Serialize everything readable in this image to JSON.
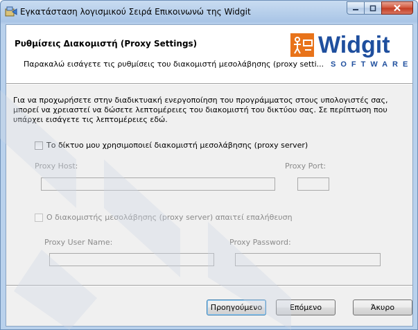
{
  "window": {
    "title": "Εγκατάσταση λογισμικού Σειρά Επικοινωνώ της Widgit",
    "icon": "installer-icon"
  },
  "banner": {
    "title": "Ρυθμίσεις Διακομιστή (Proxy Settings)",
    "description": "Παρακαλώ εισάγετε τις ρυθμίσεις του διακομιστή μεσολάβησης (proxy setti..."
  },
  "logo": {
    "brand": "Widgit",
    "tagline": "SOFTWARE",
    "colors": {
      "brand_blue": "#1f4f9e",
      "badge_orange": "#e8731a"
    }
  },
  "intro": {
    "line1": "Για να προχωρήσετε στην διαδικτυακή ενεργοποίηση του προγράμματος στους υπολογιστές σας,",
    "line2": "μπορεί να χρειαστεί να δώσετε λεπτομέρειες του διακομιστή του δικτύου σας. Σε περίπτωση που",
    "line3": "υπάρχει εισάγετε τις λεπτομέρειες εδώ."
  },
  "proxy": {
    "use_proxy_label": "Το δίκτυο μου χρησιμοποιεί διακομιστή μεσολάβησης (proxy server)",
    "use_proxy_checked": false,
    "host_label": "Proxy Host:",
    "host_value": "",
    "port_label": "Proxy Port:",
    "port_value": "",
    "auth_label": "Ο διακομιστής μεσολάβησης (proxy server) απαιτεί επαλήθευση",
    "auth_checked": false,
    "user_label": "Proxy User Name:",
    "user_value": "",
    "password_label": "Proxy Password:",
    "password_value": ""
  },
  "buttons": {
    "back": "Προηγούμενο",
    "next": "Επόμενο",
    "cancel": "Άκυρο"
  }
}
